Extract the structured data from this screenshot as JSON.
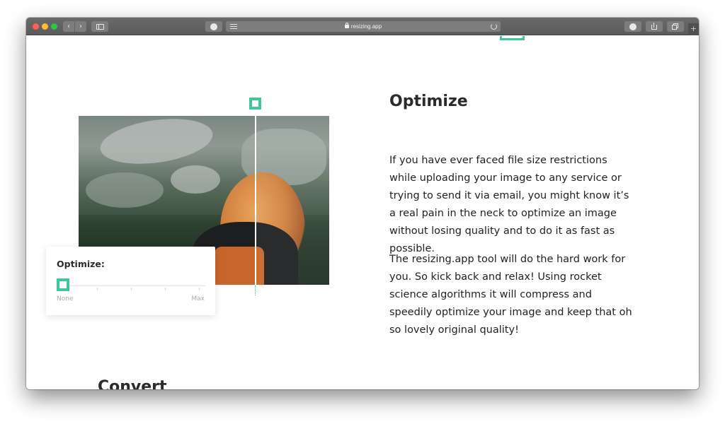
{
  "browser": {
    "url": "resizing.app",
    "newtab_symbol": "+",
    "back_symbol": "‹",
    "forward_symbol": "›"
  },
  "optimize_card": {
    "label": "Optimize:",
    "min_label": "None",
    "max_label": "Max",
    "level_fraction": 0
  },
  "section": {
    "title": "Optimize",
    "paragraphs": [
      "If you have ever faced file size restrictions while uploading your image to any service or trying to send it via email, you might know it’s a real pain in the neck to optimize an image without losing quality and to do it as fast as possible.",
      "The resizing.app tool will do the hard work for you. So kick back and relax! Using rocket science algorithms it will compress and speedily optimize your image and keep that oh so lovely original quality!"
    ]
  },
  "next_section": {
    "title": "Convert"
  },
  "colors": {
    "accent": "#3ec79a",
    "text": "#222222",
    "toolbar": "#5b5b5b"
  }
}
